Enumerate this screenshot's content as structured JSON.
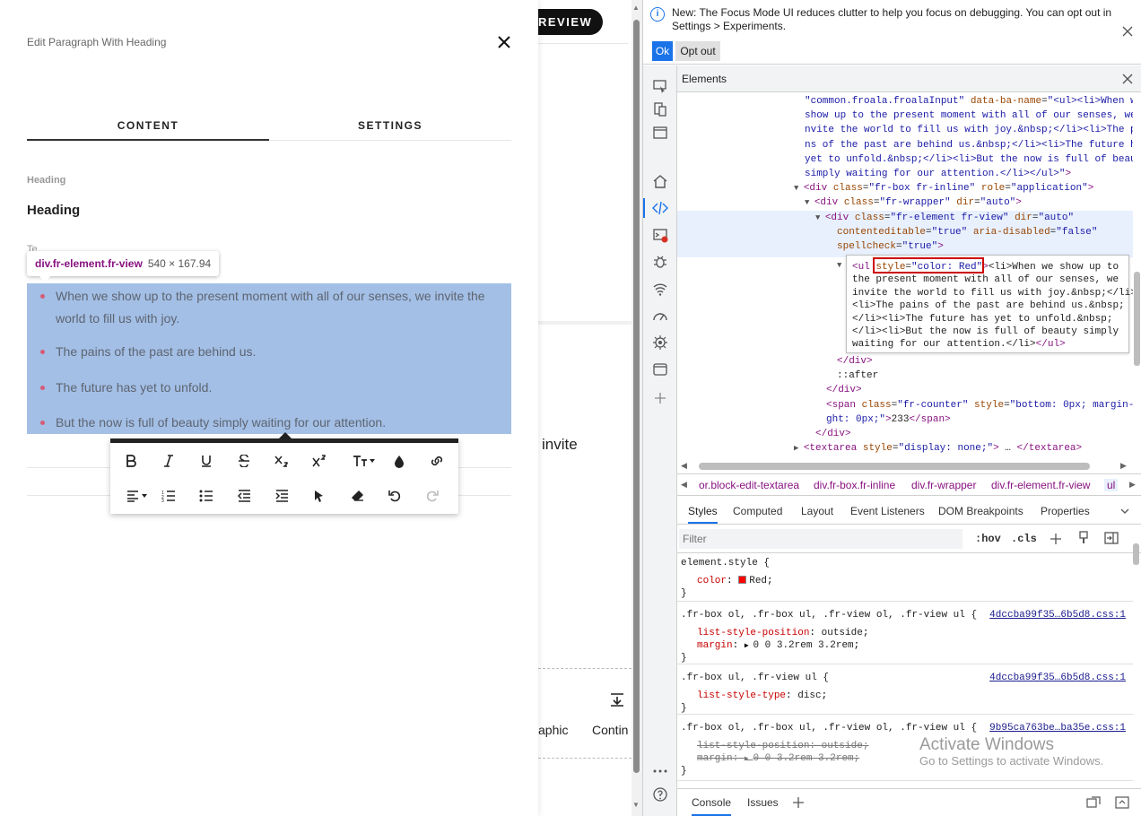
{
  "background_page": {
    "preview_label": "REVIEW",
    "partial_text_invite": "invite",
    "partial_text_aphic": "aphic",
    "partial_text_contin": "Contin"
  },
  "modal": {
    "title": "Edit Paragraph With Heading",
    "tabs": [
      {
        "label": "CONTENT",
        "active": true
      },
      {
        "label": "SETTINGS",
        "active": false
      }
    ],
    "heading_field_label": "Heading",
    "heading_value": "Heading",
    "behind_label": "Te",
    "tooltip": {
      "selector": "div.fr-element.fr-view",
      "size": "540 × 167.94"
    },
    "list_items": [
      "When we show up to the present moment with all of our senses, we invite the world to fill us with joy.",
      "The pains of the past are behind us.",
      "The future has yet to unfold.",
      "But the now is full of beauty simply waiting for our attention."
    ],
    "toolbar": {
      "row1": [
        "bold-icon",
        "italic-icon",
        "underline-icon",
        "strikethrough-icon",
        "subscript-icon",
        "superscript-icon",
        "font-size-icon",
        "text-color-icon",
        "link-icon"
      ],
      "row2": [
        "align-icon",
        "ordered-list-icon",
        "unordered-list-icon",
        "outdent-icon",
        "indent-icon",
        "select-all-icon",
        "clear-format-icon",
        "undo-icon",
        "redo-icon"
      ]
    }
  },
  "devtools": {
    "notice": {
      "text": "New: The Focus Mode UI reduces clutter to help you focus on debugging. You can opt out in Settings > Experiments.",
      "ok_label": "Ok",
      "optout_label": "Opt out"
    },
    "panel_title": "Elements",
    "dom_lines": [
      {
        "indent": 142,
        "parts": [
          [
            "val",
            "\"common.froala.froalaInput\""
          ],
          [
            "attr",
            " data-ba-name"
          ],
          [
            "txt",
            "="
          ],
          [
            "val",
            "\"<ul><li>When we"
          ]
        ]
      },
      {
        "indent": 142,
        "parts": [
          [
            "val",
            "show up to the present moment with all of our senses, we i"
          ]
        ]
      },
      {
        "indent": 142,
        "parts": [
          [
            "val",
            "nvite the world to fill us with joy.&nbsp;</li><li>The pai"
          ]
        ]
      },
      {
        "indent": 142,
        "parts": [
          [
            "val",
            "ns of the past are behind us.&nbsp;</li><li>The future has"
          ]
        ]
      },
      {
        "indent": 142,
        "parts": [
          [
            "val",
            "yet to unfold.&nbsp;</li><li>But the now is full of beauty"
          ]
        ]
      },
      {
        "indent": 142,
        "parts": [
          [
            "val",
            "simply waiting for our attention.</li></ul>\""
          ],
          [
            "tag",
            ">"
          ]
        ]
      },
      {
        "indent": 142,
        "tri": "▼",
        "parts": [
          [
            "tag",
            "<div"
          ],
          [
            "attr",
            " class"
          ],
          [
            "txt",
            "="
          ],
          [
            "val",
            "\"fr-box fr-inline\""
          ],
          [
            "attr",
            " role"
          ],
          [
            "txt",
            "="
          ],
          [
            "val",
            "\"application\""
          ],
          [
            "tag",
            ">"
          ]
        ]
      },
      {
        "indent": 154,
        "tri": "▼",
        "parts": [
          [
            "tag",
            "<div"
          ],
          [
            "attr",
            " class"
          ],
          [
            "txt",
            "="
          ],
          [
            "val",
            "\"fr-wrapper\""
          ],
          [
            "attr",
            " dir"
          ],
          [
            "txt",
            "="
          ],
          [
            "val",
            "\"auto\""
          ],
          [
            "tag",
            ">"
          ]
        ]
      },
      {
        "indent": 166,
        "tri": "▼",
        "parts": [
          [
            "tag",
            "<div"
          ],
          [
            "attr",
            " class"
          ],
          [
            "txt",
            "="
          ],
          [
            "val",
            "\"fr-element fr-view\""
          ],
          [
            "attr",
            " dir"
          ],
          [
            "txt",
            "="
          ],
          [
            "val",
            "\"auto\""
          ]
        ]
      },
      {
        "indent": 178,
        "parts": [
          [
            "attr",
            "contenteditable"
          ],
          [
            "txt",
            "="
          ],
          [
            "val",
            "\"true\""
          ],
          [
            "attr",
            " aria-disabled"
          ],
          [
            "txt",
            "="
          ],
          [
            "val",
            "\"false\""
          ]
        ]
      },
      {
        "indent": 178,
        "parts": [
          [
            "attr",
            "spellcheck"
          ],
          [
            "txt",
            "="
          ],
          [
            "val",
            "\"true\""
          ],
          [
            "tag",
            ">"
          ]
        ]
      }
    ],
    "selected_ul_lines": [
      [
        [
          "tag",
          "<ul"
        ],
        [
          "attr",
          " style"
        ],
        [
          "txt",
          "="
        ],
        [
          "val",
          "\"color: Red\""
        ],
        [
          "tag",
          ">"
        ],
        [
          "txt",
          "<li>When we show up to"
        ]
      ],
      [
        [
          "txt",
          "the present moment with all of our senses, we"
        ]
      ],
      [
        [
          "txt",
          "invite the world to fill us with joy.&nbsp;</li>"
        ]
      ],
      [
        [
          "txt",
          "<li>The pains of the past are behind us.&nbsp;"
        ]
      ],
      [
        [
          "txt",
          "</li><li>The future has yet to unfold.&nbsp;"
        ]
      ],
      [
        [
          "txt",
          "</li><li>But the now is full of beauty simply"
        ]
      ],
      [
        [
          "txt",
          "waiting for our attention.</li>"
        ],
        [
          "tag",
          "</ul>"
        ]
      ]
    ],
    "dom_after_lines": [
      {
        "indent": 178,
        "parts": [
          [
            "tag",
            "</div>"
          ]
        ]
      },
      {
        "indent": 178,
        "parts": [
          [
            "txt",
            "::after"
          ]
        ]
      },
      {
        "indent": 166,
        "parts": [
          [
            "tag",
            "</div>"
          ]
        ]
      },
      {
        "indent": 166,
        "parts": [
          [
            "tag",
            "<span"
          ],
          [
            "attr",
            " class"
          ],
          [
            "txt",
            "="
          ],
          [
            "val",
            "\"fr-counter\""
          ],
          [
            "attr",
            " style"
          ],
          [
            "txt",
            "="
          ],
          [
            "val",
            "\"bottom: 0px; margin-ri"
          ]
        ]
      },
      {
        "indent": 166,
        "parts": [
          [
            "val",
            "ght: 0px;\""
          ],
          [
            "tag",
            ">"
          ],
          [
            "txt",
            "233"
          ],
          [
            "tag",
            "</span>"
          ]
        ]
      },
      {
        "indent": 154,
        "parts": [
          [
            "tag",
            "</div>"
          ]
        ]
      },
      {
        "indent": 142,
        "tri": "▶",
        "parts": [
          [
            "tag",
            "<textarea"
          ],
          [
            "attr",
            " style"
          ],
          [
            "txt",
            "="
          ],
          [
            "val",
            "\"display: none;\""
          ],
          [
            "tag",
            ">"
          ],
          [
            "txt",
            " … "
          ],
          [
            "tag",
            "</textarea>"
          ]
        ]
      }
    ],
    "breadcrumbs": [
      "or.block-edit-textarea",
      "div.fr-box.fr-inline",
      "div.fr-wrapper",
      "div.fr-element.fr-view",
      "ul"
    ],
    "styles_tabs": [
      "Styles",
      "Computed",
      "Layout",
      "Event Listeners",
      "DOM Breakpoints",
      "Properties"
    ],
    "filter_placeholder": "Filter",
    "filter_hov": ":hov",
    "filter_cls": ".cls",
    "rules": [
      {
        "selector": "element.style {",
        "source": "",
        "decls": [
          {
            "prop": "color",
            "value": "Red",
            "swatch": true,
            "struck": false
          }
        ]
      },
      {
        "selector": ".fr-box ol, .fr-box ul, .fr-view ol, .fr-view ul {",
        "source": "4dccba99f35…6b5d8.css:1",
        "decls": [
          {
            "prop": "list-style-position",
            "value": "outside",
            "struck": false
          },
          {
            "prop": "margin",
            "value": "0 0 3.2rem 3.2rem",
            "struck": false,
            "arrow": true
          }
        ]
      },
      {
        "selector": ".fr-box ul, .fr-view ul {",
        "source": "4dccba99f35…6b5d8.css:1",
        "decls": [
          {
            "prop": "list-style-type",
            "value": "disc",
            "struck": false
          }
        ]
      },
      {
        "selector": ".fr-box ol, .fr-box ul, .fr-view ol, .fr-view ul {",
        "source": "9b95ca763be…ba35e.css:1",
        "decls": [
          {
            "prop": "list-style-position",
            "value": "outside",
            "struck": true
          },
          {
            "prop": "margin",
            "value": "0 0 3.2rem 3.2rem",
            "struck": true,
            "arrow": true
          }
        ]
      }
    ],
    "watermark": {
      "line1": "Activate Windows",
      "line2": "Go to Settings to activate Windows."
    },
    "drawer_tabs": [
      "Console",
      "Issues"
    ]
  }
}
